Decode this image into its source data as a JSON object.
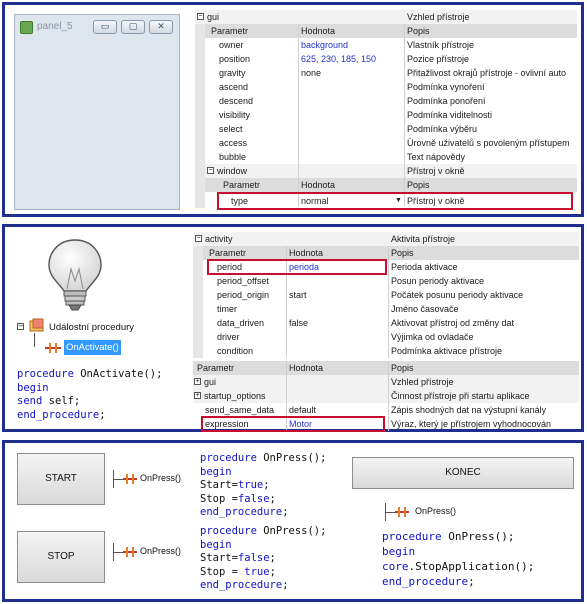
{
  "window": {
    "title": "panel_5",
    "minimize_glyph": "▭",
    "maximize_glyph": "▢",
    "close_glyph": "✕"
  },
  "gui_grid": {
    "group_name": "gui",
    "group_desc": "Vzhled přístroje",
    "headers": [
      "Parametr",
      "Hodnota",
      "Popis"
    ],
    "rows": [
      {
        "param": "owner",
        "value": "background",
        "desc": "Vlastník přístroje"
      },
      {
        "param": "position",
        "value": "625, 230, 185, 150",
        "desc": "Pozice přístroje"
      },
      {
        "param": "gravity",
        "value": "none",
        "desc": "Přitažlivost okrajů přístroje - ovlivní auto"
      },
      {
        "param": "ascend",
        "value": "",
        "desc": "Podmínka vynoření"
      },
      {
        "param": "descend",
        "value": "",
        "desc": "Podmínka ponoření"
      },
      {
        "param": "visibility",
        "value": "",
        "desc": "Podmínka viditelnosti"
      },
      {
        "param": "select",
        "value": "",
        "desc": "Podmínka výběru"
      },
      {
        "param": "access",
        "value": "",
        "desc": "Úrovně uživatelů s povoleným přístupem"
      },
      {
        "param": "bubble",
        "value": "",
        "desc": "Text nápovědy"
      }
    ],
    "window_group": "window",
    "window_desc": "Přístroj v okně",
    "window_headers": [
      "Parametr",
      "Hodnota",
      "Popis"
    ],
    "window_row": {
      "param": "type",
      "value": "normal",
      "desc": "Přístroj v okně"
    }
  },
  "activity_grid": {
    "group_name": "activity",
    "group_desc": "Aktivita přístroje",
    "headers": [
      "Parametr",
      "Hodnota",
      "Popis"
    ],
    "rows": [
      {
        "param": "period",
        "value": "perioda",
        "desc": "Perioda aktivace"
      },
      {
        "param": "period_offset",
        "value": "",
        "desc": "Posun periody aktivace"
      },
      {
        "param": "period_origin",
        "value": "start",
        "desc": "Počátek posunu periody aktivace"
      },
      {
        "param": "timer",
        "value": "",
        "desc": "Jméno časovače"
      },
      {
        "param": "data_driven",
        "value": "false",
        "desc": "Aktivovat přístroj od změny dat"
      },
      {
        "param": "driver",
        "value": "",
        "desc": "Výjimka od ovladače"
      },
      {
        "param": "condition",
        "value": "",
        "desc": "Podmínka aktivace přístroje"
      }
    ]
  },
  "startup_grid": {
    "headers": [
      "Parametr",
      "Hodnota",
      "Popis"
    ],
    "rows": [
      {
        "param": "gui",
        "value": "",
        "desc": "Vzhled přístroje",
        "group": true
      },
      {
        "param": "startup_options",
        "value": "",
        "desc": "Činnost přístroje při startu aplikace",
        "group": true
      },
      {
        "param": "send_same_data",
        "value": "default",
        "desc": "Zápis shodných dat na výstupní kanály"
      },
      {
        "param": "expression",
        "value": "Motor",
        "desc": "Výraz, který je přístrojem vyhodnocován"
      }
    ]
  },
  "event_tree": {
    "root": "Událostní procedury",
    "child": "OnActivate()"
  },
  "code_activate": [
    "procedure OnActivate();",
    "begin",
    "send self;",
    "end_procedure;"
  ],
  "buttons": {
    "start": "START",
    "stop": "STOP",
    "konec": "KONEC",
    "event": "OnPress()"
  },
  "code_start": [
    "procedure OnPress();",
    "begin",
    "Start=true;",
    "Stop =false;",
    "end_procedure;"
  ],
  "code_stop": [
    "procedure OnPress();",
    "begin",
    "Start=false;",
    "Stop = true;",
    "end_procedure;"
  ],
  "code_konec": [
    "procedure OnPress();",
    "begin",
    "core.StopApplication();",
    "end_procedure;"
  ],
  "colors": {
    "frame": "#1f2f8f",
    "highlight": "#c8102e",
    "keyword": "#1212c8"
  },
  "icons": {
    "app": "app-icon",
    "event": "event-procedure-icon",
    "bulb": "light-bulb-icon",
    "folder": "procedures-folder-icon"
  }
}
